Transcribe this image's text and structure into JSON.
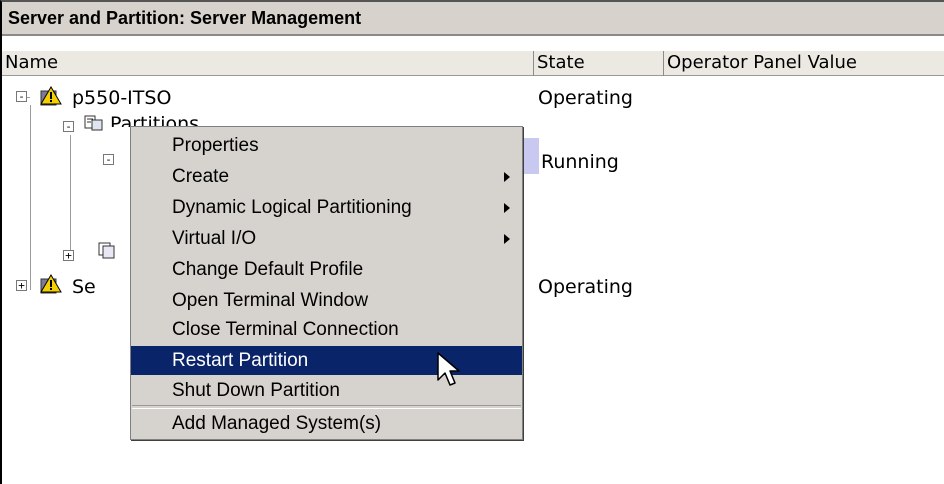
{
  "window": {
    "title": "Server and Partition: Server Management"
  },
  "columns": {
    "name": "Name",
    "state": "State",
    "operator_panel": "Operator Panel Value"
  },
  "tree": {
    "server1": {
      "name": "p550-ITSO",
      "state": "Operating"
    },
    "partitions": {
      "name": "Partitions"
    },
    "partition_child": {
      "state": "Running"
    },
    "server2": {
      "name_visible": "Se",
      "state": "Operating"
    }
  },
  "context_menu": {
    "items": [
      {
        "label": "Properties",
        "submenu": false
      },
      {
        "label": "Create",
        "submenu": true
      },
      {
        "label": "Dynamic Logical Partitioning",
        "submenu": true
      },
      {
        "label": "Virtual I/O",
        "submenu": true
      },
      {
        "label": "Change Default Profile",
        "submenu": false
      },
      {
        "label": "Open Terminal Window",
        "submenu": false
      },
      {
        "label": "Close Terminal Connection",
        "submenu": false
      },
      {
        "label": "Restart Partition",
        "submenu": false,
        "selected": true
      },
      {
        "label": "Shut Down Partition",
        "submenu": false
      },
      {
        "label": "Add Managed System(s)",
        "submenu": false
      }
    ]
  },
  "icons": {
    "server": "warning-triangle-icon",
    "partitions": "partitions-icon",
    "system_profiles": "stacked-pages-icon",
    "cursor": "mouse-pointer-icon"
  },
  "colors": {
    "selection": "#0a246a",
    "menu_bg": "#d6d3ce",
    "header_bg": "#d7d3cc"
  }
}
